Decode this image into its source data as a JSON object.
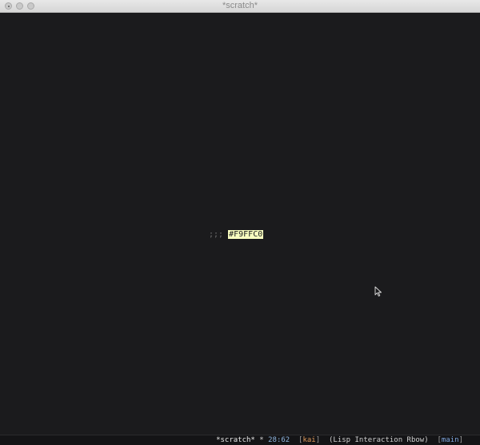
{
  "window": {
    "title": "*scratch*"
  },
  "editor": {
    "comment_prefix": ";;; ",
    "color_token": "#F9FFC0",
    "highlight_color": "#f9ffc0"
  },
  "modeline": {
    "buffer": "*scratch*",
    "modified": " * ",
    "position": "28:62",
    "user": "kai",
    "mode": "(Lisp Interaction Rbow)",
    "branch": "main"
  },
  "icons": {
    "pointer": "mouse-pointer-icon"
  }
}
